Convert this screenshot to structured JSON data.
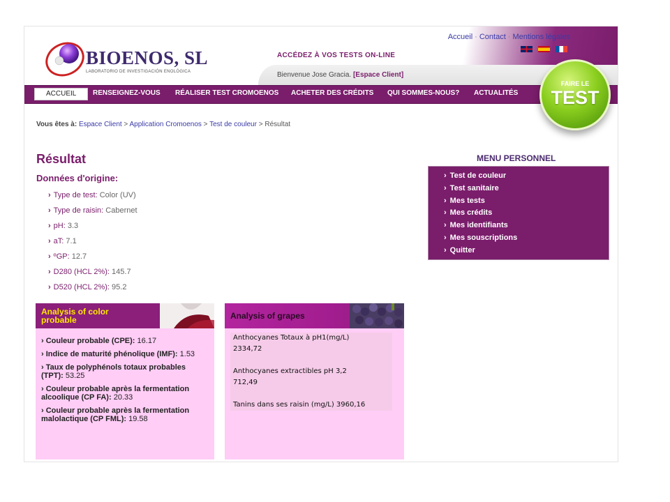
{
  "header": {
    "brand": "BIOENOS, SL",
    "brand_sub": "LABORATORIO DE INVESTIGACIÓN ENOLÓGICA",
    "access_text": "ACCÉDEZ À VOS TESTS ON-LINE",
    "welcome_text": "Bienvenue Jose Gracia.",
    "client_link": "[Espace Client]",
    "top_links": [
      "Accueil",
      "Contact",
      "Mentions légales"
    ],
    "flags": [
      "uk-flag-icon",
      "es-flag-icon",
      "fr-flag-icon"
    ]
  },
  "nav": {
    "items": [
      "ACCUEIL",
      "RENSEIGNEZ-VOUS",
      "RÉALISER TEST CROMOENOS",
      "ACHETER DES CRÉDITS",
      "QUI SOMMES-NOUS?",
      "ACTUALITÉS"
    ]
  },
  "badge": {
    "small": "FAIRE LE",
    "big": "TEST"
  },
  "breadcrumb": {
    "label": "Vous êtes à:",
    "items": [
      "Espace Client",
      "Application Cromoenos",
      "Test de couleur",
      "Résultat"
    ]
  },
  "result": {
    "title": "Résultat",
    "subtitle": "Données d'origine:",
    "origin": [
      {
        "label": "Type de test:",
        "value": "Color (UV)"
      },
      {
        "label": "Type de raisin:",
        "value": "Cabernet"
      },
      {
        "label": "pH:",
        "value": "3.3"
      },
      {
        "label": "aT:",
        "value": "7.1"
      },
      {
        "label": "ºGP:",
        "value": "12.7"
      },
      {
        "label": "D280 (HCL 2%):",
        "value": "145.7"
      },
      {
        "label": "D520 (HCL 2%):",
        "value": "95.2"
      }
    ]
  },
  "menu": {
    "title": "MENU PERSONNEL",
    "items": [
      "Test de couleur",
      "Test sanitaire",
      "Mes tests",
      "Mes crédits",
      "Mes identifiants",
      "Mes souscriptions",
      "Quitter"
    ]
  },
  "color_box": {
    "title": "Analysis of color probable",
    "items": [
      {
        "label": "Couleur probable (CPE):",
        "value": "16.17"
      },
      {
        "label": "Indice de maturité phénolique (IMF):",
        "value": "1.53"
      },
      {
        "label": "Taux de polyphénols totaux probables (TPT):",
        "value": "53.25"
      },
      {
        "label": "Couleur probable après la fermentation alcoolique (CP FA):",
        "value": "20.33"
      },
      {
        "label": "Couleur probable après la fermentation malolactique (CP FML):",
        "value": "19.58"
      }
    ]
  },
  "grapes_box": {
    "title": "Analysis of grapes",
    "lines": [
      "Anthocyanes Totaux à pH1(mg/L)",
      "2334,72",
      "Anthocyanes extractibles pH 3,2",
      "712,49",
      "Tanins dans ses raisin (mg/L) 3960,16"
    ]
  },
  "colors": {
    "brand_purple": "#7a1d6b",
    "box_pink": "#ffcdf6",
    "accent_green": "#8ccf20",
    "link_blue": "#3a3aa8"
  }
}
